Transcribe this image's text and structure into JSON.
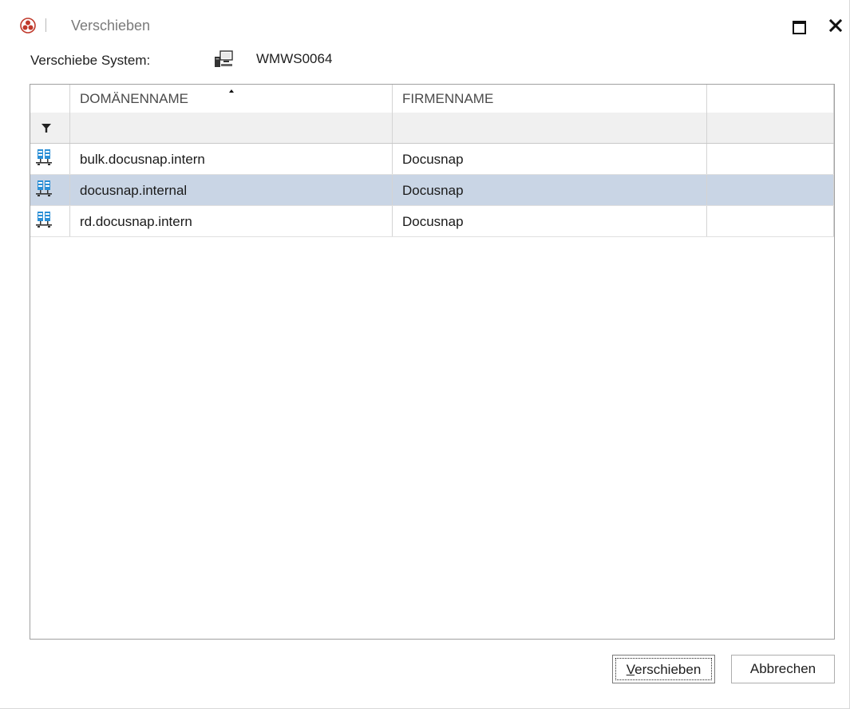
{
  "window": {
    "title": "Verschieben"
  },
  "header": {
    "system_label": "Verschiebe System:",
    "system_icon": "workstation-icon",
    "system_name": "WMWS0064"
  },
  "grid": {
    "columns": [
      "DOMÄNENNAME",
      "FIRMENNAME",
      ""
    ],
    "sorted_column": "DOMÄNENNAME",
    "filter_icon": "filter-icon",
    "rows": [
      {
        "icon": "domain-icon",
        "domain": "bulk.docusnap.intern",
        "company": "Docusnap",
        "selected": false
      },
      {
        "icon": "domain-icon",
        "domain": "docusnap.internal",
        "company": "Docusnap",
        "selected": true
      },
      {
        "icon": "domain-icon",
        "domain": "rd.docusnap.intern",
        "company": "Docusnap",
        "selected": false
      }
    ]
  },
  "buttons": {
    "move": {
      "underlined": "V",
      "rest": "erschieben"
    },
    "cancel": "Abbrechen"
  },
  "colors": {
    "selection": "#c9d5e5",
    "app_icon": "#c0392b",
    "domain_icon": "#2b8fd6"
  }
}
